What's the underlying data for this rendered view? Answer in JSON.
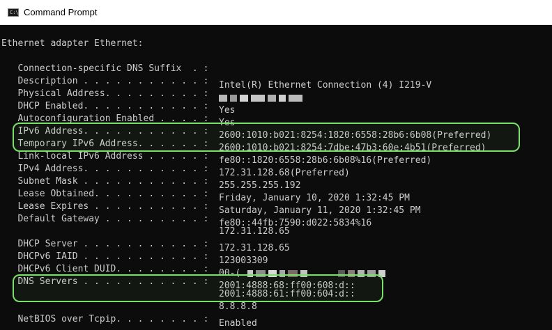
{
  "window": {
    "title": "Command Prompt",
    "icon": "cmd-icon",
    "icon_text": "C:\\."
  },
  "console": {
    "header": "Ethernet adapter Ethernet:",
    "rows": [
      {
        "label": "   Connection-specific DNS Suffix  . :",
        "value": ""
      },
      {
        "label": "   Description . . . . . . . . . . . :",
        "value": "Intel(R) Ethernet Connection (4) I219-V"
      },
      {
        "label": "   Physical Address. . . . . . . . . :",
        "value": ""
      },
      {
        "label": "   DHCP Enabled. . . . . . . . . . . :",
        "value": "Yes"
      },
      {
        "label": "   Autoconfiguration Enabled . . . . :",
        "value": "Yes"
      },
      {
        "label": "   IPv6 Address. . . . . . . . . . . :",
        "value": "2600:1010:b021:8254:1820:6558:28b6:6b08(Preferred)"
      },
      {
        "label": "   Temporary IPv6 Address. . . . . . :",
        "value": "2600:1010:b021:8254:7dbe:47b3:60e:4b51(Preferred)"
      },
      {
        "label": "   Link-local IPv6 Address . . . . . :",
        "value": "fe80::1820:6558:28b6:6b08%16(Preferred)"
      },
      {
        "label": "   IPv4 Address. . . . . . . . . . . :",
        "value": "172.31.128.68(Preferred)"
      },
      {
        "label": "   Subnet Mask . . . . . . . . . . . :",
        "value": "255.255.255.192"
      },
      {
        "label": "   Lease Obtained. . . . . . . . . . :",
        "value": "Friday, January 10, 2020 1:32:45 PM"
      },
      {
        "label": "   Lease Expires . . . . . . . . . . :",
        "value": "Saturday, January 11, 2020 1:32:45 PM"
      },
      {
        "label": "   Default Gateway . . . . . . . . . :",
        "value": "fe80::44fb:7590:d022:5834%16"
      },
      {
        "label": "",
        "value": "172.31.128.65"
      },
      {
        "label": "   DHCP Server . . . . . . . . . . . :",
        "value": "172.31.128.65"
      },
      {
        "label": "   DHCPv6 IAID . . . . . . . . . . . :",
        "value": "123003309"
      },
      {
        "label": "   DHCPv6 Client DUID. . . . . . . . :",
        "value": "00-("
      },
      {
        "label": "   DNS Servers . . . . . . . . . . . :",
        "value": "2001:4888:68:ff00:608:d::"
      },
      {
        "label": "",
        "value": "2001:4888:61:ff00:604:d::"
      },
      {
        "label": "",
        "value": "8.8.8.8"
      },
      {
        "label": "   NetBIOS over Tcpip. . . . . . . . :",
        "value": "Enabled"
      }
    ]
  },
  "colors": {
    "console_bg": "#0c0c0c",
    "console_text": "#cccccc",
    "highlight": "#7be06a",
    "redaction": "#c0c0c0"
  }
}
